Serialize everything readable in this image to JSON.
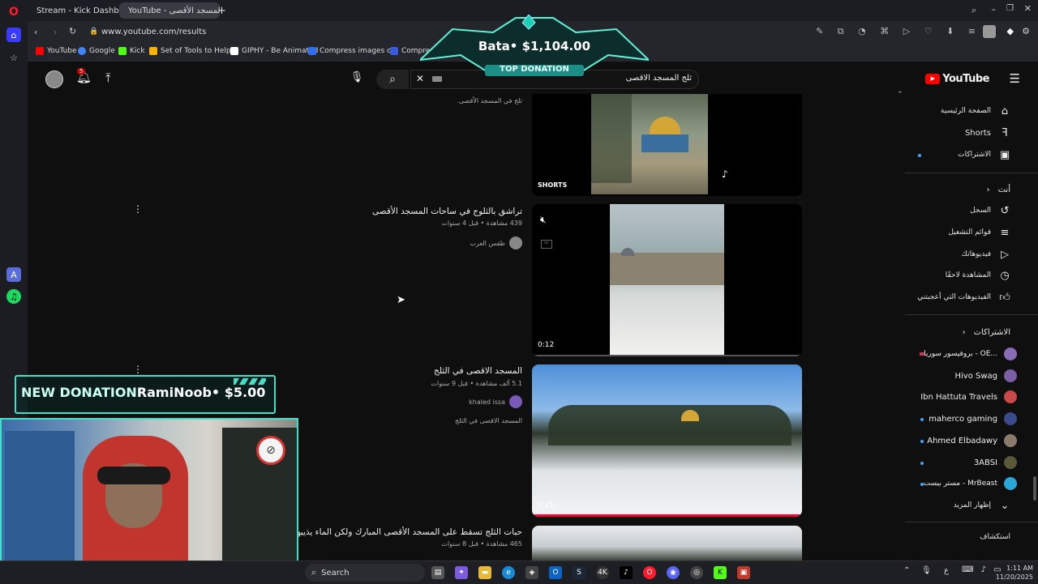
{
  "browser": {
    "tabs": [
      {
        "label": "Stream - Kick Dashboard",
        "favicon_color": "#53fc18"
      },
      {
        "label": "(3) ثلج المسجد الأقصى - YouTube",
        "favicon_color": "#ff0000"
      }
    ],
    "url": "www.youtube.com/results",
    "bookmarks": [
      {
        "label": "YouTube",
        "color": "#ff0000"
      },
      {
        "label": "Google",
        "color": "#4285f4"
      },
      {
        "label": "Kick",
        "color": "#53fc18"
      },
      {
        "label": "Set of Tools to Help...",
        "color": "#f5b400"
      },
      {
        "label": "GIPHY - Be Animated",
        "color": "#ffffff"
      },
      {
        "label": "Compress images o...",
        "color": "#2f6fed"
      },
      {
        "label": "Compress",
        "color": "#3b5bdb"
      }
    ]
  },
  "youtube": {
    "logo_text": "YouTube",
    "notif_count": "5",
    "search_query": "ثلج المسجد الاقصى",
    "sidebar": {
      "main": [
        "الصفحة الرئيسية",
        "Shorts",
        "الاشتراكات"
      ],
      "you_header": "أنت",
      "you_items": [
        "السجل",
        "قوائم التشغيل",
        "فيديوهاتك",
        "المشاهدة لاحقًا",
        "الفيديوهات التي أعجبتني"
      ],
      "subs_header": "الاشتراكات",
      "subs": [
        {
          "name": "بروفيسور سوريا - OE...",
          "color": "#8a6bb8"
        },
        {
          "name": "Hivo Swag",
          "color": "#7b5ea7"
        },
        {
          "name": "Ibn Hattuta Travels",
          "color": "#c94a4a"
        },
        {
          "name": "maherco gaming",
          "color": "#3a4a8a"
        },
        {
          "name": "Ahmed Elbadawy",
          "color": "#8a7a6a"
        },
        {
          "name": "3ABSI",
          "color": "#5a5a3a"
        },
        {
          "name": "مستر بيست - MrBeast",
          "color": "#2aa8d8"
        }
      ],
      "show_more": "إظهار المزيد",
      "explore": "استكشاف"
    },
    "results": [
      {
        "title": "",
        "meta": "",
        "desc": "ثلج في المسجد الأقصى.",
        "badge": "SHORTS",
        "duration": ""
      },
      {
        "title": "تراشق بالثلوج في ساحات المسجد الأقصى",
        "meta": "439 مشاهدة • قبل 4 سنوات",
        "channel": "طقس العرب",
        "duration": "0:12"
      },
      {
        "title": "المسجد الاقصى في الثلج",
        "meta": "5.1 ألف مشاهدة • قبل 9 سنوات",
        "channel": "khaled issa",
        "desc": "المسجد الاقصى في الثلج",
        "duration": "0:25"
      },
      {
        "title": "حبات الثلج تسقط على المسجد الأقصى المبارك ولكن الماء يذيبها",
        "meta": "465 مشاهدة • قبل 8 سنوات",
        "duration": ""
      }
    ]
  },
  "overlays": {
    "top_donation_name": "Bata",
    "top_donation_amount": "$1,104.00",
    "top_donation_label": "TOP DONATION",
    "new_donation_label": "NEW DONATION",
    "new_donation_name": "RamiNoob",
    "new_donation_amount": "$5.00"
  },
  "taskbar": {
    "search_label": "Search",
    "lang": "ع",
    "time": "1:11 AM",
    "date": "11/20/2025"
  }
}
